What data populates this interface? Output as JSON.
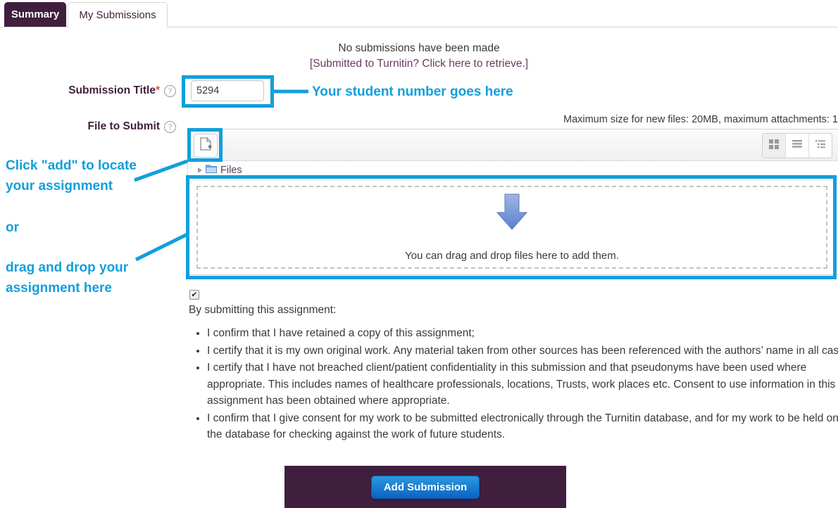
{
  "tabs": [
    {
      "label": "Summary",
      "active": true
    },
    {
      "label": "My Submissions",
      "active": false
    }
  ],
  "status": {
    "line1": "No submissions have been made",
    "line2": "[Submitted to Turnitin? Click here to retrieve.]"
  },
  "form": {
    "title_label": "Submission Title",
    "required_mark": "*",
    "help_glyph": "?",
    "title_value": "5294",
    "title_placeholder": "",
    "file_label": "File to Submit",
    "max_size_note": "Maximum size for new files: 20MB, maximum attachments: 1"
  },
  "filemanager": {
    "breadcrumb_label": "Files",
    "dropzone_text": "You can drag and drop files here to add them.",
    "view_modes": [
      {
        "name": "icons-view",
        "active": true
      },
      {
        "name": "list-view",
        "active": false
      },
      {
        "name": "tree-view",
        "active": false
      }
    ]
  },
  "declaration": {
    "checked": true,
    "check_glyph": "✔",
    "heading": "By submitting this assignment:",
    "items": [
      "I confirm that I have retained a copy of this assignment;",
      "I certify that it is my own original work. Any material taken from other sources has been referenced with the authors’ name in all cases;",
      "I certify that I have not breached client/patient confidentiality in this submission and that pseudonyms have been used where appropriate. This includes names of healthcare professionals, locations, Trusts, work places etc. Consent to use information in this assignment has been obtained where appropriate.",
      "I confirm that I give consent for my work to be submitted electronically through the Turnitin database, and for my work to be held on the database for checking against the work of future students."
    ]
  },
  "submit": {
    "button_label": "Add Submission"
  },
  "annotations": {
    "accent_color": "#119fdc",
    "student_number": "Your student number goes here",
    "click_add_line1": "Click \"add\" to locate",
    "click_add_line2": "your assignment",
    "or": "or",
    "drag_drop_line1": "drag and drop your",
    "drag_drop_line2": "assignment here"
  }
}
